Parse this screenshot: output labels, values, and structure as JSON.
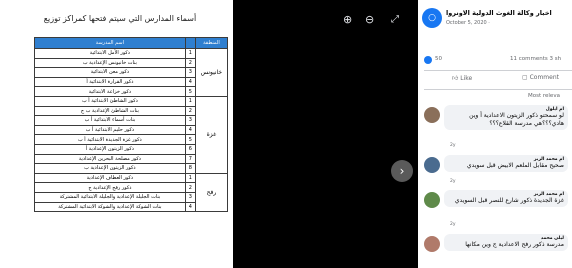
{
  "document": {
    "title": "أسماء المدارس التي سيتم فتحها كمراكز توزيع",
    "table": {
      "headers": [
        "المنطقة",
        "",
        "اسم المدرسة"
      ],
      "groups": [
        {
          "region": "خانيونس",
          "rows": [
            {
              "num": "1",
              "school": "ذكور الأمل الابتدائية"
            },
            {
              "num": "2",
              "school": "بنات خانيونس الإعدادية ب"
            },
            {
              "num": "3",
              "school": "ذكور معن الابتدائية"
            },
            {
              "num": "4",
              "school": "ذكور القرارة الابتدائية أ"
            },
            {
              "num": "5",
              "school": "ذكور خزاعة الابتدائية"
            }
          ]
        },
        {
          "region": "غزة",
          "rows": [
            {
              "num": "1",
              "school": "ذكور الشاطئ الابتدائية أ ب"
            },
            {
              "num": "2",
              "school": "بنات الشاطئ الإعدادية ب ج"
            },
            {
              "num": "3",
              "school": "بنات أسماء الابتدائية أ ب"
            },
            {
              "num": "4",
              "school": "ذكور حليم الابتدائية أ ب"
            },
            {
              "num": "5",
              "school": "ذكور غزة الجديدة الابتدائية أ ب"
            },
            {
              "num": "6",
              "school": "ذكور الزيتون الإعدادية أ"
            },
            {
              "num": "7",
              "school": "ذكور مصلحة البحرين الإعدادية"
            },
            {
              "num": "8",
              "school": "ذكور الزيتون الإعدادية ب"
            }
          ]
        },
        {
          "region": "رفح",
          "rows": [
            {
              "num": "1",
              "school": "ذكور العطاف الإعدادية"
            },
            {
              "num": "2",
              "school": "ذكور رفح الإعدادية ج"
            },
            {
              "num": "3",
              "school": "بنات الجليلة الإعدادية والجليلة الابتدائية المشتركة"
            },
            {
              "num": "4",
              "school": "بنات الشوكة الإعدادية والشوكة الابتدائية المشتركة"
            }
          ]
        }
      ]
    }
  },
  "viewer": {
    "zoom_in_icon": "⊕",
    "zoom_out_icon": "⊖",
    "expand_icon": "⤢",
    "next_icon": "›"
  },
  "post": {
    "page_name": "اخبار وكالة الغوث الدولية الاونروا",
    "date": "October 5, 2020 · ",
    "reaction_count": "50",
    "comments_count": "11 comments  3 sh",
    "like_label": "Like",
    "comment_label": "Comment",
    "sort_label": "Most releva"
  },
  "comments": [
    {
      "author": "ام ايلول",
      "text": "لو سمحتو ذكور الزيتون الاعدادية أ وين هادي؟؟؟هي مدرسة القلاع؟؟؟",
      "time": "2y"
    },
    {
      "author": "ام محمد الزبر",
      "text": "صحيح مقابل الملعم الابيض قبل سويدي",
      "time": "2y"
    },
    {
      "author": "ام محمد الزبر",
      "text": "غزة الجديدة ذكور شارع للنصر قبل السويدي",
      "time": "2y"
    },
    {
      "author": "ليلى محمد",
      "text": "مدرسة ذكور رفح الاعدادية ج وين مكانها",
      "time": "2y"
    }
  ]
}
